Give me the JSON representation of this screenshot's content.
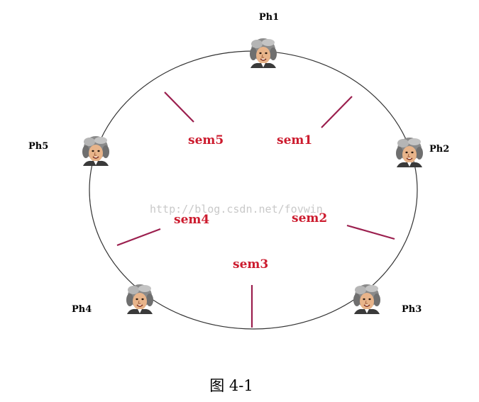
{
  "colors": {
    "circle": "#333333",
    "semaphore": "#cc1b2e",
    "stick": "#9b1f4e",
    "watermark": "#c9c9c9",
    "background": "#ffffff"
  },
  "philosophers": [
    {
      "id": "ph1",
      "label": "Ph1",
      "icon": "philosopher-face-icon"
    },
    {
      "id": "ph2",
      "label": "Ph2",
      "icon": "philosopher-face-icon"
    },
    {
      "id": "ph3",
      "label": "Ph3",
      "icon": "philosopher-face-icon"
    },
    {
      "id": "ph4",
      "label": "Ph4",
      "icon": "philosopher-face-icon"
    },
    {
      "id": "ph5",
      "label": "Ph5",
      "icon": "philosopher-face-icon"
    }
  ],
  "semaphores": [
    {
      "id": "sem1",
      "label": "sem1"
    },
    {
      "id": "sem2",
      "label": "sem2"
    },
    {
      "id": "sem3",
      "label": "sem3"
    },
    {
      "id": "sem4",
      "label": "sem4"
    },
    {
      "id": "sem5",
      "label": "sem5"
    }
  ],
  "watermark": "http://blog.csdn.net/fovwin",
  "caption": "图 4-1"
}
